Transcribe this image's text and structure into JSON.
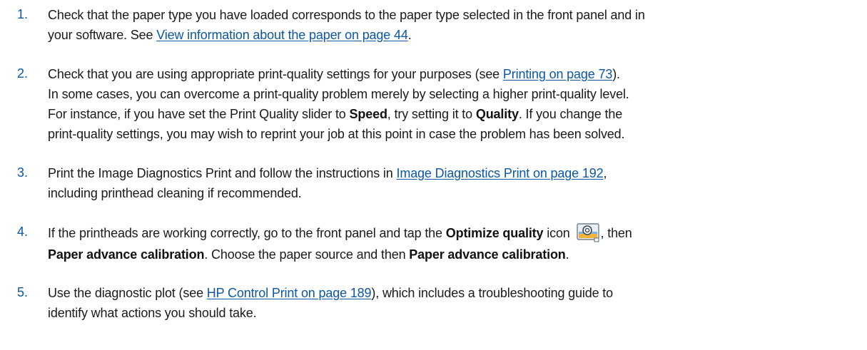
{
  "steps": [
    {
      "number": "1.",
      "t1": "Check that the paper type you have loaded corresponds to the paper type selected in the front panel and in",
      "t2": "your software. See ",
      "link1": "View information about the paper on page 44",
      "t3": "."
    },
    {
      "number": "2.",
      "t1": "Check that you are using appropriate print-quality settings for your purposes (see ",
      "link1": "Printing on page 73",
      "t2": ").",
      "t3": "In some cases, you can overcome a print-quality problem merely by selecting a higher print-quality level.",
      "t4": "For instance, if you have set the Print Quality slider to ",
      "b1": "Speed",
      "t5": ", try setting it to ",
      "b2": "Quality",
      "t6": ". If you change the",
      "t7": "print-quality settings, you may wish to reprint your job at this point in case the problem has been solved."
    },
    {
      "number": "3.",
      "t1": "Print the Image Diagnostics Print and follow the instructions in ",
      "link1": "Image Diagnostics Print on page 192",
      "t2": ",",
      "t3": "including printhead cleaning if recommended."
    },
    {
      "number": "4.",
      "t1": "If the printheads are working correctly, go to the front panel and tap the ",
      "b1": "Optimize quality",
      "t2": "  icon ",
      "icon": "optimize-quality-icon",
      "t3": ", then",
      "b2": "Paper advance calibration",
      "t4": ". Choose the paper source and then ",
      "b3": "Paper advance calibration",
      "t5": "."
    },
    {
      "number": "5.",
      "t1": "Use the diagnostic plot (see ",
      "link1": "HP Control Print on page 189",
      "t2": "), which includes a troubleshooting guide to",
      "t3": "identify what actions you should take."
    }
  ],
  "colors": {
    "accent": "#0d57a8",
    "text": "#1a1a1a"
  }
}
